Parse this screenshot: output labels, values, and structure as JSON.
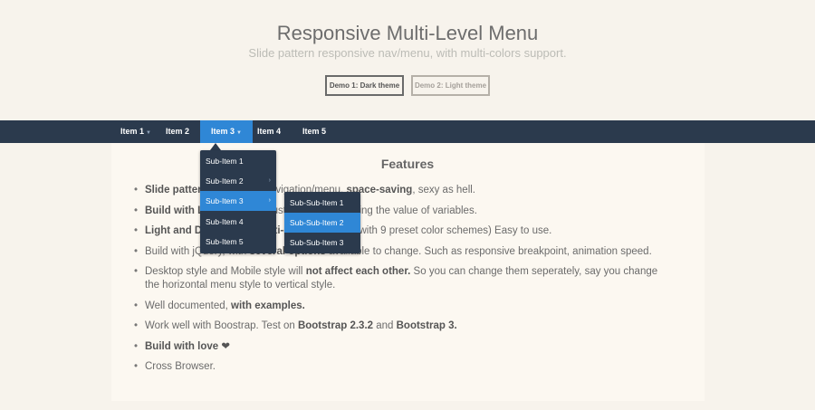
{
  "header": {
    "title": "Responsive Multi-Level Menu",
    "subtitle": "Slide pattern responsive nav/menu, with multi-colors support.",
    "demo_buttons": [
      "Demo 1: Dark theme",
      "Demo 2: Light theme"
    ]
  },
  "nav": {
    "items": [
      {
        "label": "Item 1",
        "has_submenu": true
      },
      {
        "label": "Item 2",
        "has_submenu": false
      },
      {
        "label": "Item 3",
        "has_submenu": true,
        "active": true
      },
      {
        "label": "Item 4",
        "has_submenu": false
      },
      {
        "label": "Item 5",
        "has_submenu": false
      }
    ],
    "caret_icon": "chevron-down-icon"
  },
  "submenu": {
    "items": [
      {
        "label": "Sub-Item 1",
        "has_submenu": false
      },
      {
        "label": "Sub-Item 2",
        "has_submenu": true
      },
      {
        "label": "Sub-Item 3",
        "has_submenu": true,
        "active": true
      },
      {
        "label": "Sub-Item 4",
        "has_submenu": false
      },
      {
        "label": "Sub-Item 5",
        "has_submenu": false
      }
    ],
    "caret_icon": "chevron-right-icon"
  },
  "subsubmenu": {
    "items": [
      {
        "label": "Sub-Sub-Item 1"
      },
      {
        "label": "Sub-Sub-Item 2",
        "active": true
      },
      {
        "label": "Sub-Sub-Item 3"
      }
    ]
  },
  "content": {
    "heading": "Features",
    "features": [
      [
        {
          "t": "Slide pattern",
          "b": true
        },
        {
          "t": " responsive navigation/menu, "
        },
        {
          "t": "space-saving",
          "b": true
        },
        {
          "t": ", sexy as hell."
        }
      ],
      [
        {
          "t": "Build with LESS",
          "b": true
        },
        {
          "t": ", easy to customize by changing the value of variables."
        }
      ],
      [
        {
          "t": "Light and Dark",
          "b": true
        },
        {
          "t": " theme, "
        },
        {
          "t": "multi-colors",
          "b": true
        },
        {
          "t": " support (with 9 preset color schemes) Easy to use."
        }
      ],
      [
        {
          "t": "Build with jQuery, with "
        },
        {
          "t": "several options",
          "b": true
        },
        {
          "t": " available to change. Such as responsive breakpoint, animation speed."
        }
      ],
      [
        {
          "t": "Desktop style and Mobile style will "
        },
        {
          "t": "not affect each other.",
          "b": true
        },
        {
          "t": " So you can change them seperately, say you change the horizontal menu style to vertical style."
        }
      ],
      [
        {
          "t": "Well documented, "
        },
        {
          "t": "with examples.",
          "b": true
        }
      ],
      [
        {
          "t": "Work well with Boostrap. Test on "
        },
        {
          "t": "Bootstrap 2.3.2",
          "b": true
        },
        {
          "t": " and "
        },
        {
          "t": "Bootstrap 3.",
          "b": true
        }
      ],
      [
        {
          "t": "Build with love ❤",
          "b": true
        }
      ],
      [
        {
          "t": "Cross Browser."
        }
      ]
    ]
  },
  "colors": {
    "nav_bg": "#2b3a4d",
    "accent": "#2f87d6",
    "page_bg": "#f7f3ec"
  }
}
